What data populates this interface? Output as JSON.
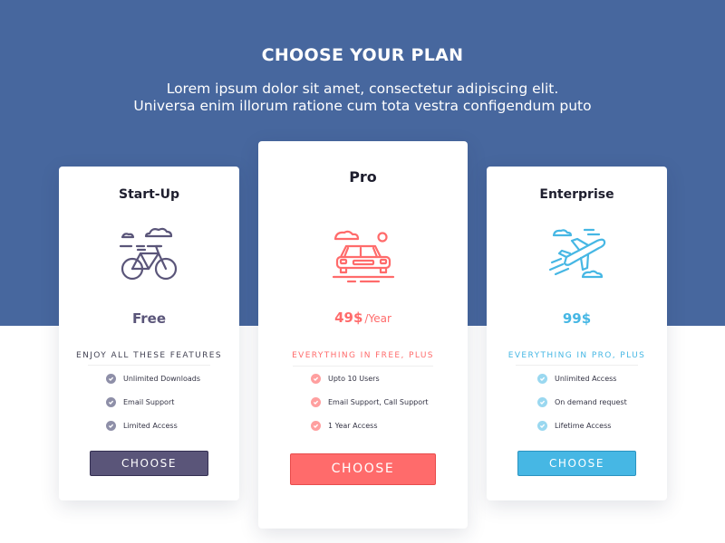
{
  "header": {
    "title": "CHOOSE YOUR PLAN",
    "subtitle_line1": "Lorem ipsum dolor sit amet, consectetur adipiscing elit.",
    "subtitle_line2": "Universa enim illorum ratione cum tota vestra configendum puto"
  },
  "colors": {
    "hero_background": "#47679e",
    "startup_accent": "#5a5579",
    "pro_accent": "#ff6b6b",
    "enterprise_accent": "#46b7e4"
  },
  "plans": [
    {
      "name": "Start-Up",
      "icon": "bicycle-icon",
      "price": "Free",
      "period": "",
      "features_heading": "ENJOY ALL THESE FEATURES",
      "features": [
        "Unlimited Downloads",
        "Email Support",
        "Limited Access"
      ],
      "button_label": "CHOOSE"
    },
    {
      "name": "Pro",
      "icon": "car-icon",
      "price": "49$",
      "period": "/Year",
      "features_heading": "EVERYTHING IN FREE, PLUS",
      "features": [
        "Upto 10 Users",
        "Email Support, Call Support",
        "1 Year Access"
      ],
      "button_label": "CHOOSE"
    },
    {
      "name": "Enterprise",
      "icon": "airplane-icon",
      "price": "99$",
      "period": "",
      "features_heading": "EVERYTHING IN PRO, PLUS",
      "features": [
        "Unlimited Access",
        "On demand request",
        "Lifetime Access"
      ],
      "button_label": "CHOOSE"
    }
  ]
}
